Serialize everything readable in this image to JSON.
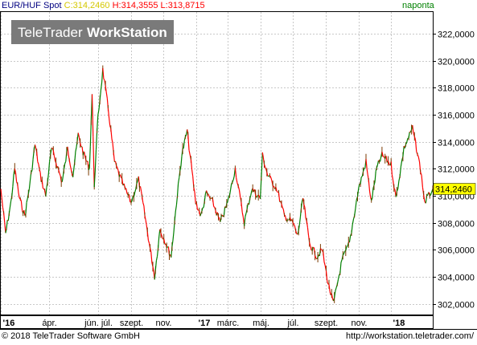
{
  "header": {
    "symbol": "EUR/HUF Spot",
    "close_label": "C:",
    "close_value": "314,2460",
    "high_label": "H:",
    "high_value": "314,3555",
    "low_label": "L:",
    "low_value": "313,8715",
    "period": "naponta"
  },
  "watermark": {
    "brand": "TeleTrader",
    "product": "WorkStation"
  },
  "footer": {
    "copyright": "© 2018 TeleTrader Software GmbH",
    "url": "http://workstation.teletrader.com/"
  },
  "colors": {
    "up": "#008000",
    "down": "#ff0000",
    "wick": "#7a3a00",
    "grid": "#c8c8c8",
    "price_tag_bg": "#ffff00",
    "close_text": "#d4c800",
    "high_text": "#ff0000",
    "low_text": "#ff0000",
    "period_text": "#008000"
  },
  "chart_data": {
    "type": "line",
    "title": "EUR/HUF Spot",
    "current_price_label": "314,2460",
    "ylim": [
      301.2,
      323.6
    ],
    "y_ticks": [
      302,
      304,
      306,
      308,
      310,
      312,
      314,
      316,
      318,
      320,
      322
    ],
    "y_tick_labels": [
      "302,0000",
      "304,0000",
      "306,0000",
      "308,0000",
      "310,0000",
      "312,0000",
      "314,0000",
      "316,0000",
      "318,0000",
      "320,0000",
      "322,0000"
    ],
    "x_range": [
      "2016-01-01",
      "2018-03-20"
    ],
    "x_ticks": [
      {
        "date": "2016-01-01",
        "label": "'16",
        "bold": true
      },
      {
        "date": "2016-04-01",
        "label": "ápr.",
        "bold": false
      },
      {
        "date": "2016-07-01",
        "label": "jún. júl.",
        "bold": false
      },
      {
        "date": "2016-09-01",
        "label": "szept.",
        "bold": false
      },
      {
        "date": "2016-11-01",
        "label": "nov.",
        "bold": false
      },
      {
        "date": "2017-01-01",
        "label": "'17",
        "bold": true
      },
      {
        "date": "2017-03-01",
        "label": "márc.",
        "bold": false
      },
      {
        "date": "2017-05-01",
        "label": "máj.",
        "bold": false
      },
      {
        "date": "2017-07-01",
        "label": "júl.",
        "bold": false
      },
      {
        "date": "2017-09-01",
        "label": "szept.",
        "bold": false
      },
      {
        "date": "2017-11-01",
        "label": "nov.",
        "bold": false
      },
      {
        "date": "2018-01-01",
        "label": "'18",
        "bold": true
      }
    ],
    "grid": true,
    "series": [
      {
        "x": [
          "2016-01-01",
          "2016-01-10",
          "2016-01-20",
          "2016-01-27",
          "2016-02-05",
          "2016-02-15",
          "2016-02-25",
          "2016-03-05",
          "2016-03-15",
          "2016-03-25",
          "2016-04-05",
          "2016-04-15",
          "2016-04-25",
          "2016-05-05",
          "2016-05-15",
          "2016-05-25",
          "2016-06-05",
          "2016-06-15",
          "2016-06-20",
          "2016-06-24",
          "2016-07-01",
          "2016-07-10",
          "2016-07-20",
          "2016-08-01",
          "2016-08-15",
          "2016-09-01",
          "2016-09-15",
          "2016-09-25",
          "2016-10-05",
          "2016-10-15",
          "2016-10-25",
          "2016-11-05",
          "2016-11-15",
          "2016-11-25",
          "2016-12-05",
          "2016-12-15",
          "2016-12-31",
          "2017-01-10",
          "2017-01-20",
          "2017-02-01",
          "2017-02-15",
          "2017-03-01",
          "2017-03-15",
          "2017-04-01",
          "2017-04-15",
          "2017-05-01",
          "2017-05-05",
          "2017-05-15",
          "2017-06-01",
          "2017-06-15",
          "2017-07-01",
          "2017-07-10",
          "2017-07-20",
          "2017-08-01",
          "2017-08-15",
          "2017-08-25",
          "2017-09-05",
          "2017-09-15",
          "2017-10-01",
          "2017-10-15",
          "2017-11-01",
          "2017-11-15",
          "2017-11-25",
          "2017-12-05",
          "2017-12-15",
          "2018-01-01",
          "2018-01-10",
          "2018-01-25",
          "2018-02-10",
          "2018-02-25",
          "2018-03-05",
          "2018-03-20"
        ],
        "values": [
          310.5,
          307.2,
          309.5,
          312.0,
          309.8,
          308.5,
          311.0,
          313.8,
          311.5,
          310.0,
          313.5,
          312.3,
          311.0,
          313.5,
          311.5,
          314.5,
          313.0,
          312.0,
          317.5,
          310.8,
          315.8,
          319.3,
          316.5,
          312.5,
          311.0,
          309.5,
          311.2,
          309.0,
          306.5,
          304.0,
          307.5,
          306.5,
          305.5,
          309.5,
          313.0,
          314.8,
          309.5,
          308.5,
          310.2,
          309.5,
          308.0,
          309.5,
          312.0,
          308.0,
          310.5,
          309.8,
          313.0,
          311.5,
          310.5,
          308.5,
          308.0,
          307.0,
          309.8,
          306.5,
          305.5,
          306.0,
          303.5,
          302.0,
          305.2,
          306.5,
          310.5,
          312.5,
          309.5,
          312.0,
          313.0,
          312.3,
          309.8,
          313.5,
          315.0,
          312.0,
          309.5,
          310.5
        ]
      }
    ]
  }
}
